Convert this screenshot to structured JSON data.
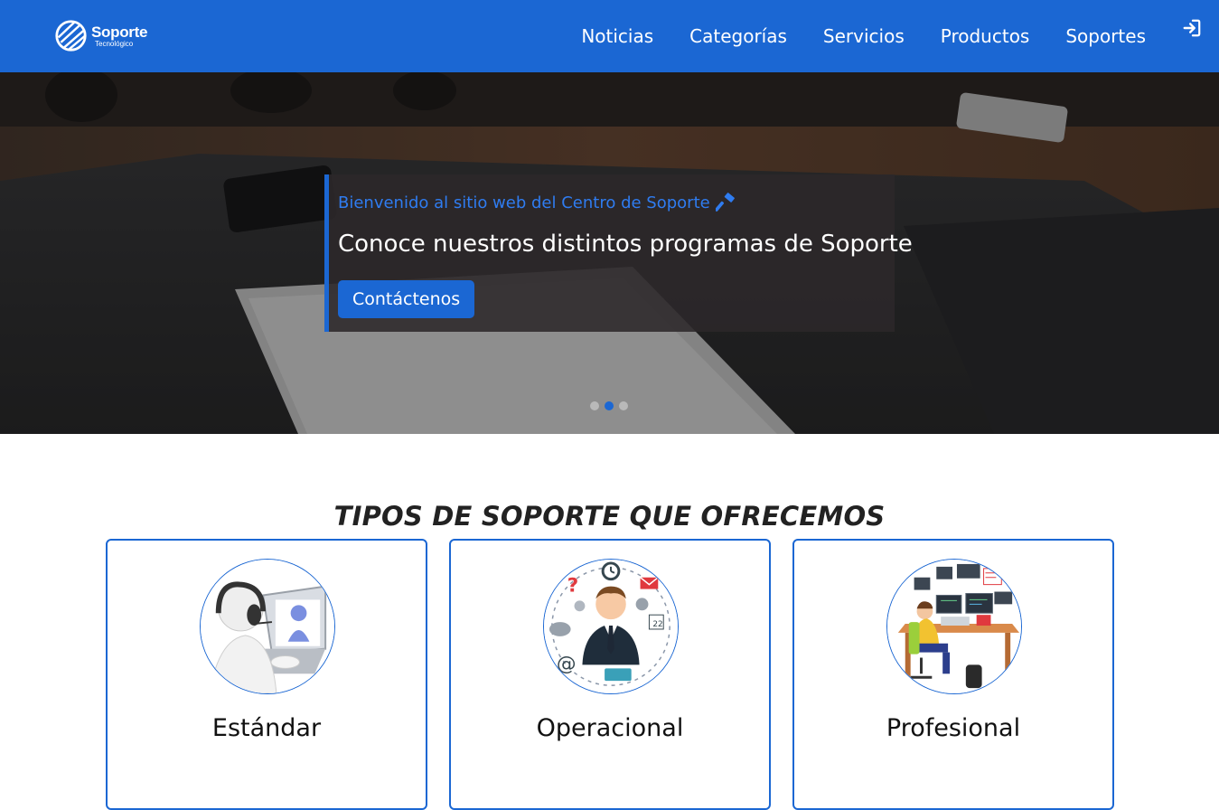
{
  "navbar": {
    "brand_name": "Soporte",
    "brand_sub": "Tecnológico",
    "links": [
      "Noticias",
      "Categorías",
      "Servicios",
      "Productos",
      "Soportes"
    ],
    "login_icon": "sign-in-icon"
  },
  "hero": {
    "eyebrow": "Bienvenido al sitio web del Centro de Soporte",
    "eyebrow_icon": "hammer-icon",
    "heading": "Conoce nuestros distintos programas de Soporte",
    "button_label": "Contáctenos",
    "slides_total": 3,
    "active_slide": 2
  },
  "section": {
    "title": "TIPOS DE SOPORTE QUE OFRECEMOS"
  },
  "cards": [
    {
      "title": "Estándar",
      "icon": "helpdesk-operator-image"
    },
    {
      "title": "Operacional",
      "icon": "business-tasks-image"
    },
    {
      "title": "Profesional",
      "icon": "developer-workstation-image"
    }
  ],
  "colors": {
    "primary": "#1b67d3",
    "eyebrow": "#2f7cf0",
    "caption_bg": "#2c282a"
  }
}
